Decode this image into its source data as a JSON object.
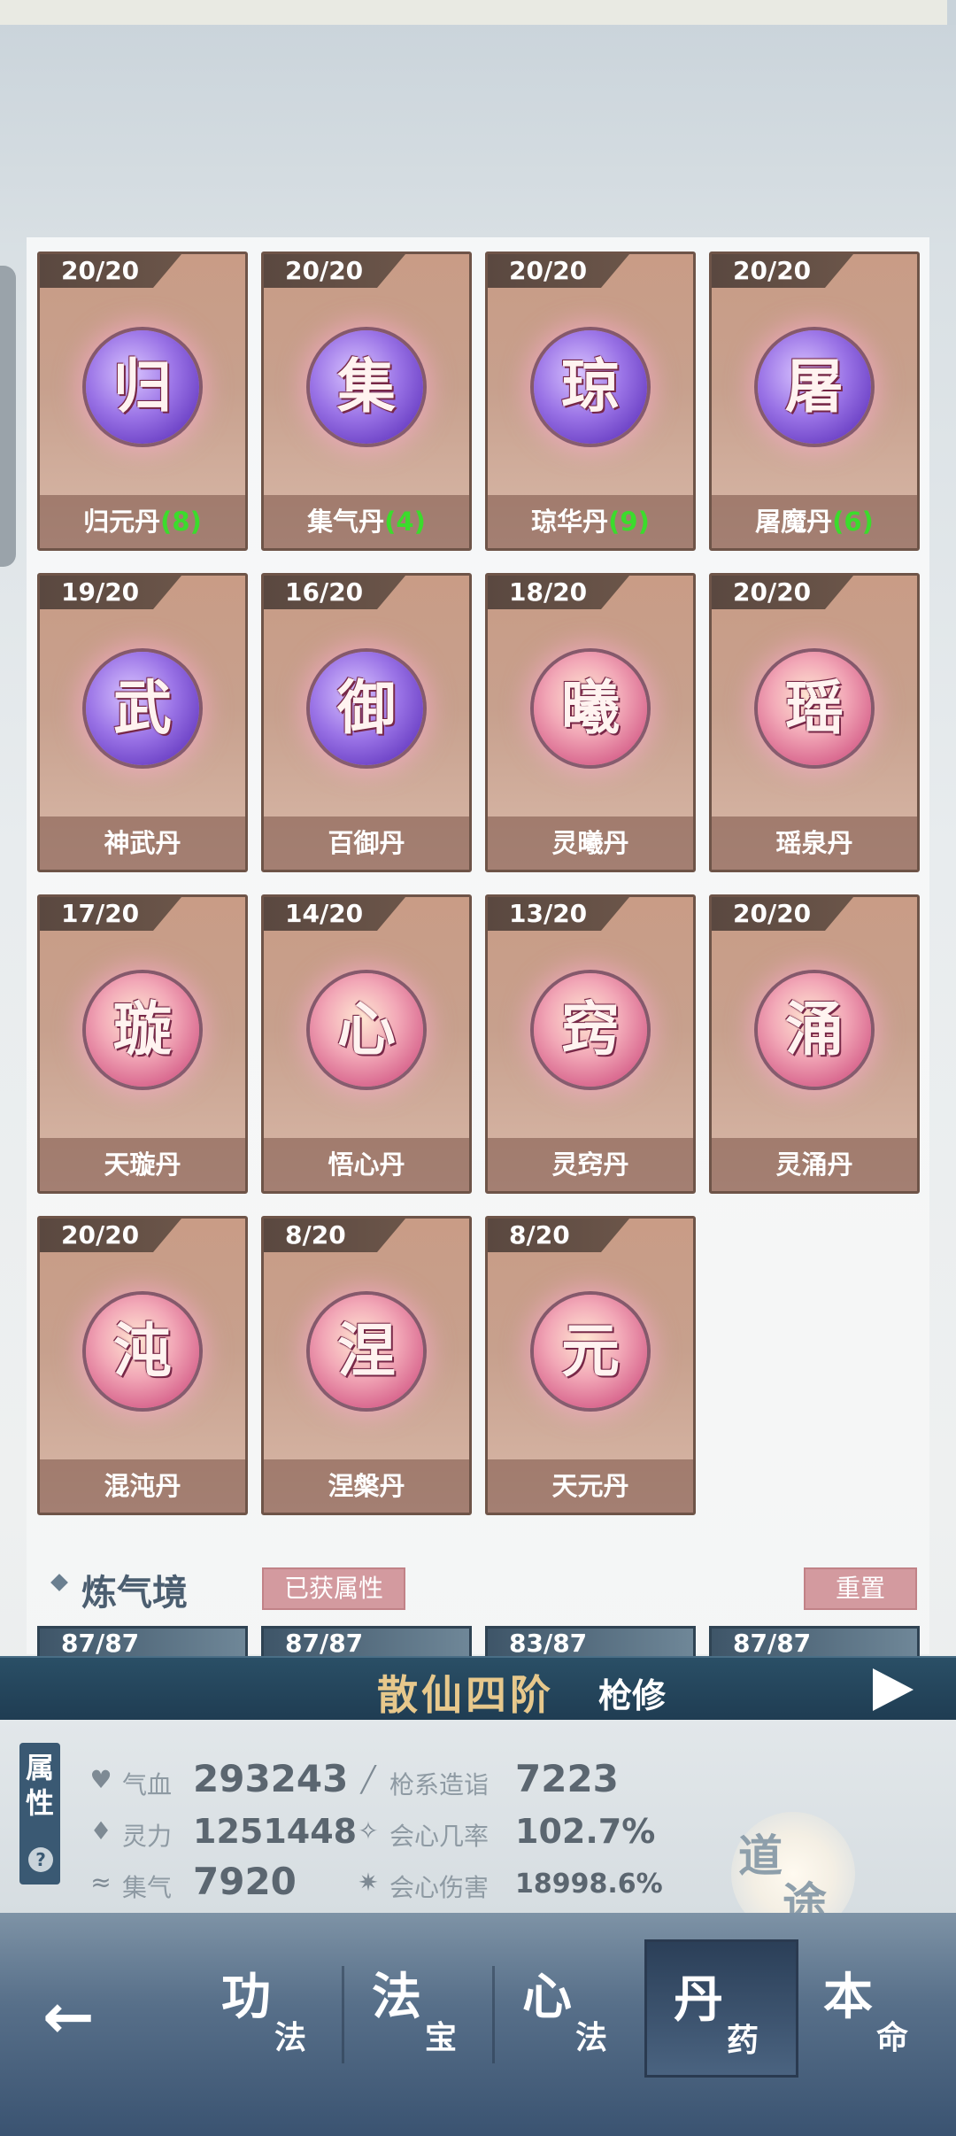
{
  "pills": [
    {
      "count": "20/20",
      "glyph": "归",
      "name": "归元丹",
      "extra": "(8)",
      "color": "purple"
    },
    {
      "count": "20/20",
      "glyph": "集",
      "name": "集气丹",
      "extra": "(4)",
      "color": "purple"
    },
    {
      "count": "20/20",
      "glyph": "琼",
      "name": "琼华丹",
      "extra": "(9)",
      "color": "purple"
    },
    {
      "count": "20/20",
      "glyph": "屠",
      "name": "屠魔丹",
      "extra": "(6)",
      "color": "purple"
    },
    {
      "count": "19/20",
      "glyph": "武",
      "name": "神武丹",
      "extra": "",
      "color": "purple"
    },
    {
      "count": "16/20",
      "glyph": "御",
      "name": "百御丹",
      "extra": "",
      "color": "purple"
    },
    {
      "count": "18/20",
      "glyph": "曦",
      "name": "灵曦丹",
      "extra": "",
      "color": "pink"
    },
    {
      "count": "20/20",
      "glyph": "瑶",
      "name": "瑶泉丹",
      "extra": "",
      "color": "pink"
    },
    {
      "count": "17/20",
      "glyph": "璇",
      "name": "天璇丹",
      "extra": "",
      "color": "pink"
    },
    {
      "count": "14/20",
      "glyph": "心",
      "name": "悟心丹",
      "extra": "",
      "color": "pink"
    },
    {
      "count": "13/20",
      "glyph": "窍",
      "name": "灵窍丹",
      "extra": "",
      "color": "pink"
    },
    {
      "count": "20/20",
      "glyph": "涌",
      "name": "灵涌丹",
      "extra": "",
      "color": "pink"
    },
    {
      "count": "20/20",
      "glyph": "沌",
      "name": "混沌丹",
      "extra": "",
      "color": "pink"
    },
    {
      "count": "8/20",
      "glyph": "涅",
      "name": "涅槃丹",
      "extra": "",
      "color": "pink"
    },
    {
      "count": "8/20",
      "glyph": "元",
      "name": "天元丹",
      "extra": "",
      "color": "pink"
    }
  ],
  "section": {
    "title": "炼气境",
    "tag": "已获属性",
    "reset": "重置"
  },
  "next_counts": [
    "87/87",
    "87/87",
    "83/87",
    "87/87"
  ],
  "realm": {
    "name": "散仙四阶",
    "class": "枪修"
  },
  "attr_tab": {
    "label": "属性",
    "help": "?"
  },
  "stats": [
    {
      "icon": "heart-icon",
      "glyph": "♥",
      "label": "气血",
      "value": "293243"
    },
    {
      "icon": "spirit-icon",
      "glyph": "♦",
      "label": "灵力",
      "value": "1251448"
    },
    {
      "icon": "swirl-icon",
      "glyph": "≈",
      "label": "集气",
      "value": "7920"
    },
    {
      "icon": "spear-icon",
      "glyph": "╱",
      "label": "枪系造诣",
      "value": "7223"
    },
    {
      "icon": "crit-rate-icon",
      "glyph": "✧",
      "label": "会心几率",
      "value": "102.7%"
    },
    {
      "icon": "crit-damage-icon",
      "glyph": "✷",
      "label": "会心伤害",
      "value": "18998.6%"
    }
  ],
  "daotu": {
    "a": "道",
    "b": "途"
  },
  "nav": [
    {
      "big": "功",
      "small": "法"
    },
    {
      "big": "法",
      "small": "宝"
    },
    {
      "big": "心",
      "small": "法"
    },
    {
      "big": "丹",
      "small": "药"
    },
    {
      "big": "本",
      "small": "命"
    }
  ],
  "back_glyph": "←"
}
